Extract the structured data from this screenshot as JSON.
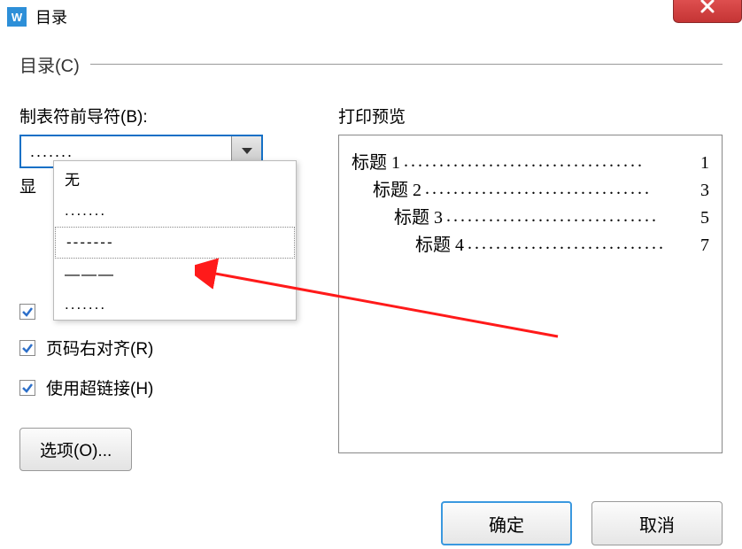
{
  "titlebar": {
    "app_icon_text": "W",
    "title": "目录"
  },
  "fieldset_label": "目录(C)",
  "leader": {
    "label": "制表符前导符(B):",
    "value": ".......",
    "options": [
      "无",
      ".......",
      "-------",
      "———",
      "......."
    ],
    "selected_index": 2
  },
  "partial_label": "显",
  "checkboxes": {
    "hidden_partial": {
      "checked": true
    },
    "right_align": {
      "label": "页码右对齐(R)",
      "checked": true
    },
    "hyperlink": {
      "label": "使用超链接(H)",
      "checked": true
    }
  },
  "options_btn": "选项(O)...",
  "preview": {
    "label": "打印预览",
    "rows": [
      {
        "title": "标题 1",
        "page": "1",
        "indent": 0
      },
      {
        "title": "标题 2",
        "page": "3",
        "indent": 1
      },
      {
        "title": "标题 3",
        "page": "5",
        "indent": 2
      },
      {
        "title": "标题 4",
        "page": "7",
        "indent": 3
      }
    ]
  },
  "buttons": {
    "ok": "确定",
    "cancel": "取消"
  }
}
